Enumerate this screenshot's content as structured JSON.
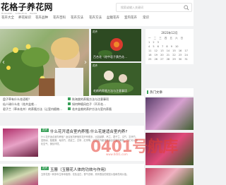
{
  "header": {
    "logo_title": "花格子养花网",
    "logo_sub": "HUAGEZI · YANGHUA · WANG",
    "search_placeholder": "搜索或输入关键词"
  },
  "nav": [
    "花卉大全",
    "养花知识",
    "花卉品种",
    "花卉百科",
    "花卉方法",
    "花卉方法",
    "盆栽花卉",
    "室内花卉",
    "常识"
  ],
  "slider": {
    "prev": "‹",
    "next": "›"
  },
  "thumbs": [
    {
      "tag": "花卉",
      "caption": "百合花（花中君子黄色花…"
    },
    {
      "tag": "花卉",
      "caption": "毛鹃的养殖方法与注意事项"
    },
    {
      "tag": "花卉",
      "caption": "盆栽花卉，花卉的养殖与…"
    },
    {
      "tag": "花卉",
      "caption": "花卉（花卉养殖详细步骤…"
    }
  ],
  "calendar": {
    "title": "2023年12月",
    "rows": [
      "一 二 三 四 五 六 日",
      "        1 2 3",
      "4 5 6 7 8 9 10",
      "11 12 13 14 15 16 17",
      "18 19 20 21 22 23 24",
      "25 26 27 28 29 30 31"
    ]
  },
  "hot": {
    "title": "热门文章"
  },
  "short_list": [
    "盘子草有什么花语呢？",
    "仙人球什么花（花卉盆栽…",
    "君子兰（草本花卉）的养殖方法（让室内植物…",
    "秋海棠的养殖方法与注意事项",
    "如何种植风信子（不开花…",
    "花卉盆栽的养护方法与室内养殖"
  ],
  "articles": [
    {
      "cat": "花卉",
      "title": "什么花开适合室内养殖:什么花是适合室内养?",
      "desc": "什么花开适合室内养殖？适合室内养殖的花卉有很多，比如绿萝、吊兰、君子兰、文竹、富贵竹、发财树、散尾葵、龟背竹、虎皮兰、白掌、红掌等，这些花卉都非常适合在室内养殖，它们可以净化空气、美化环境。"
    },
    {
      "cat": "花卉",
      "title": "玉簪（玉簪花人体的功效与作用）",
      "desc": "玉簪花是一种多年生草本植物，花色洁白，香气浓郁，具有很高的观赏价值和药用价值。"
    }
  ],
  "watermark": {
    "text": "0401号航库",
    "sub": "www.0401.com"
  }
}
